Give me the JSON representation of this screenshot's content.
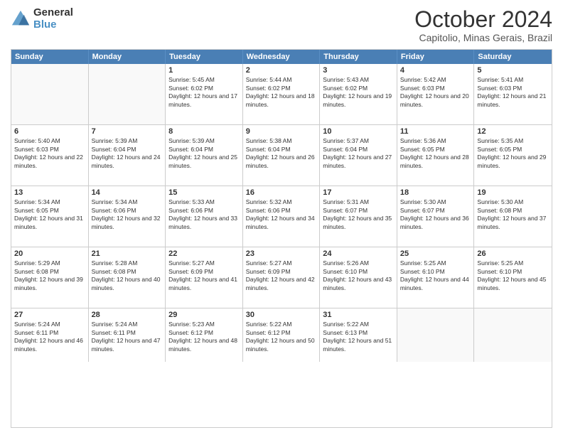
{
  "logo": {
    "general": "General",
    "blue": "Blue"
  },
  "header": {
    "month": "October 2024",
    "location": "Capitolio, Minas Gerais, Brazil"
  },
  "days": [
    "Sunday",
    "Monday",
    "Tuesday",
    "Wednesday",
    "Thursday",
    "Friday",
    "Saturday"
  ],
  "rows": [
    [
      {
        "day": "",
        "empty": true
      },
      {
        "day": "",
        "empty": true
      },
      {
        "day": "1",
        "sunrise": "5:45 AM",
        "sunset": "6:02 PM",
        "daylight": "12 hours and 17 minutes."
      },
      {
        "day": "2",
        "sunrise": "5:44 AM",
        "sunset": "6:02 PM",
        "daylight": "12 hours and 18 minutes."
      },
      {
        "day": "3",
        "sunrise": "5:43 AM",
        "sunset": "6:02 PM",
        "daylight": "12 hours and 19 minutes."
      },
      {
        "day": "4",
        "sunrise": "5:42 AM",
        "sunset": "6:03 PM",
        "daylight": "12 hours and 20 minutes."
      },
      {
        "day": "5",
        "sunrise": "5:41 AM",
        "sunset": "6:03 PM",
        "daylight": "12 hours and 21 minutes."
      }
    ],
    [
      {
        "day": "6",
        "sunrise": "5:40 AM",
        "sunset": "6:03 PM",
        "daylight": "12 hours and 22 minutes."
      },
      {
        "day": "7",
        "sunrise": "5:39 AM",
        "sunset": "6:04 PM",
        "daylight": "12 hours and 24 minutes."
      },
      {
        "day": "8",
        "sunrise": "5:39 AM",
        "sunset": "6:04 PM",
        "daylight": "12 hours and 25 minutes."
      },
      {
        "day": "9",
        "sunrise": "5:38 AM",
        "sunset": "6:04 PM",
        "daylight": "12 hours and 26 minutes."
      },
      {
        "day": "10",
        "sunrise": "5:37 AM",
        "sunset": "6:04 PM",
        "daylight": "12 hours and 27 minutes."
      },
      {
        "day": "11",
        "sunrise": "5:36 AM",
        "sunset": "6:05 PM",
        "daylight": "12 hours and 28 minutes."
      },
      {
        "day": "12",
        "sunrise": "5:35 AM",
        "sunset": "6:05 PM",
        "daylight": "12 hours and 29 minutes."
      }
    ],
    [
      {
        "day": "13",
        "sunrise": "5:34 AM",
        "sunset": "6:05 PM",
        "daylight": "12 hours and 31 minutes."
      },
      {
        "day": "14",
        "sunrise": "5:34 AM",
        "sunset": "6:06 PM",
        "daylight": "12 hours and 32 minutes."
      },
      {
        "day": "15",
        "sunrise": "5:33 AM",
        "sunset": "6:06 PM",
        "daylight": "12 hours and 33 minutes."
      },
      {
        "day": "16",
        "sunrise": "5:32 AM",
        "sunset": "6:06 PM",
        "daylight": "12 hours and 34 minutes."
      },
      {
        "day": "17",
        "sunrise": "5:31 AM",
        "sunset": "6:07 PM",
        "daylight": "12 hours and 35 minutes."
      },
      {
        "day": "18",
        "sunrise": "5:30 AM",
        "sunset": "6:07 PM",
        "daylight": "12 hours and 36 minutes."
      },
      {
        "day": "19",
        "sunrise": "5:30 AM",
        "sunset": "6:08 PM",
        "daylight": "12 hours and 37 minutes."
      }
    ],
    [
      {
        "day": "20",
        "sunrise": "5:29 AM",
        "sunset": "6:08 PM",
        "daylight": "12 hours and 39 minutes."
      },
      {
        "day": "21",
        "sunrise": "5:28 AM",
        "sunset": "6:08 PM",
        "daylight": "12 hours and 40 minutes."
      },
      {
        "day": "22",
        "sunrise": "5:27 AM",
        "sunset": "6:09 PM",
        "daylight": "12 hours and 41 minutes."
      },
      {
        "day": "23",
        "sunrise": "5:27 AM",
        "sunset": "6:09 PM",
        "daylight": "12 hours and 42 minutes."
      },
      {
        "day": "24",
        "sunrise": "5:26 AM",
        "sunset": "6:10 PM",
        "daylight": "12 hours and 43 minutes."
      },
      {
        "day": "25",
        "sunrise": "5:25 AM",
        "sunset": "6:10 PM",
        "daylight": "12 hours and 44 minutes."
      },
      {
        "day": "26",
        "sunrise": "5:25 AM",
        "sunset": "6:10 PM",
        "daylight": "12 hours and 45 minutes."
      }
    ],
    [
      {
        "day": "27",
        "sunrise": "5:24 AM",
        "sunset": "6:11 PM",
        "daylight": "12 hours and 46 minutes."
      },
      {
        "day": "28",
        "sunrise": "5:24 AM",
        "sunset": "6:11 PM",
        "daylight": "12 hours and 47 minutes."
      },
      {
        "day": "29",
        "sunrise": "5:23 AM",
        "sunset": "6:12 PM",
        "daylight": "12 hours and 48 minutes."
      },
      {
        "day": "30",
        "sunrise": "5:22 AM",
        "sunset": "6:12 PM",
        "daylight": "12 hours and 50 minutes."
      },
      {
        "day": "31",
        "sunrise": "5:22 AM",
        "sunset": "6:13 PM",
        "daylight": "12 hours and 51 minutes."
      },
      {
        "day": "",
        "empty": true
      },
      {
        "day": "",
        "empty": true
      }
    ]
  ]
}
